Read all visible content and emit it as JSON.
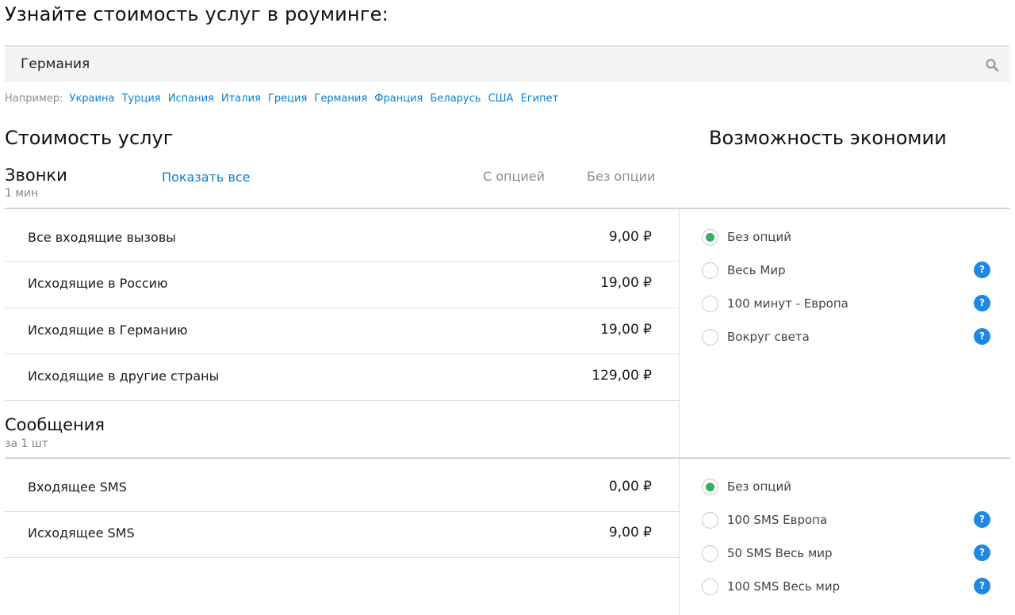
{
  "page_title": "Узнайте стоимость услуг в роуминге:",
  "search": {
    "value": "Германия",
    "placeholder": ""
  },
  "examples": {
    "label": "Например:",
    "countries": [
      "Украина",
      "Турция",
      "Испания",
      "Италия",
      "Греция",
      "Германия",
      "Франция",
      "Беларусь",
      "США",
      "Египет"
    ]
  },
  "cost_section_title": "Стоимость услуг",
  "economy_section_title": "Возможность экономии",
  "calls": {
    "title": "Звонки",
    "unit": "1 мин",
    "show_all": "Показать все",
    "col_with_option": "С опцией",
    "col_without_option": "Без опции",
    "rows": [
      {
        "label": "Все входящие вызовы",
        "price": "9,00 ₽"
      },
      {
        "label": "Исходящие в Россию",
        "price": "19,00 ₽"
      },
      {
        "label": "Исходящие в Германию",
        "price": "19,00 ₽"
      },
      {
        "label": "Исходящие в другие страны",
        "price": "129,00 ₽"
      }
    ],
    "options": [
      {
        "label": "Без опций",
        "checked": true,
        "help": false
      },
      {
        "label": "Весь Мир",
        "checked": false,
        "help": true
      },
      {
        "label": "100 минут - Европа",
        "checked": false,
        "help": true
      },
      {
        "label": "Вокруг света",
        "checked": false,
        "help": true
      }
    ]
  },
  "sms": {
    "title": "Сообщения",
    "unit": "за 1 шт",
    "rows": [
      {
        "label": "Входящее SMS",
        "price": "0,00 ₽"
      },
      {
        "label": "Исходящее SMS",
        "price": "9,00 ₽"
      }
    ],
    "options": [
      {
        "label": "Без опций",
        "checked": true,
        "help": false
      },
      {
        "label": "100 SMS Европа",
        "checked": false,
        "help": true
      },
      {
        "label": "50 SMS Весь мир",
        "checked": false,
        "help": true
      },
      {
        "label": "100 SMS Весь мир",
        "checked": false,
        "help": true
      }
    ]
  },
  "help_glyph": "?",
  "icons": {
    "search": "search-icon",
    "help": "help-icon"
  },
  "colors": {
    "link": "#0a7fd0",
    "radio_checked": "#2db35d",
    "help_badge": "#1e88e5"
  }
}
